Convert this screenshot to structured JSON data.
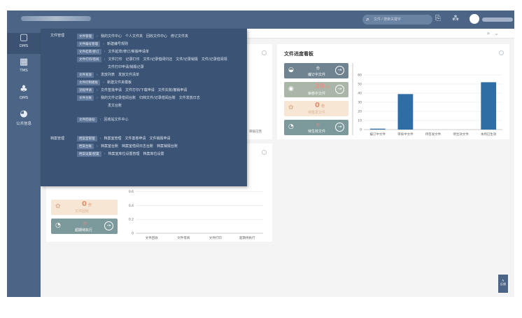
{
  "search": {
    "placeholder": "文件 / 搜索关键字"
  },
  "nav": [
    {
      "label": "DMS",
      "icon": "document-icon",
      "glyph": "🗋"
    },
    {
      "label": "TMS",
      "icon": "grid-icon",
      "glyph": "▦"
    },
    {
      "label": "QMS",
      "icon": "org-chart-icon",
      "glyph": "♣"
    },
    {
      "label": "公共信息",
      "icon": "pie-chart-icon",
      "glyph": "◕"
    }
  ],
  "menu": {
    "sections": [
      {
        "title": "文件管理"
      },
      {
        "title": "档案管理"
      }
    ],
    "rows": [
      {
        "tag": "文件管理",
        "links": [
          "我的文件中心",
          "个人文件夹",
          "回收文件中心",
          "修订文件夹"
        ]
      },
      {
        "tag": "文件编号管理",
        "links": [
          "新建编号规则"
        ]
      },
      {
        "tag": "文件起草/修订",
        "links": [
          "文件起草/修订/新版申请单"
        ]
      },
      {
        "tag": "文件打印/借阅",
        "links": [
          "文件打印",
          "记录打印",
          "文件/记录借阅归还",
          "文件/记录销毁",
          "文件/记录借阅领"
        ]
      },
      {
        "tag": "",
        "links": [
          "文件打印申请/销毁记录"
        ]
      },
      {
        "tag": "文件发放",
        "links": [
          "发放列表",
          "发放文件清单"
        ]
      },
      {
        "tag": "文件控制模板",
        "links": [
          "新建文件夹模板"
        ]
      },
      {
        "tag": "流程申请",
        "links": [
          "文件签批申请",
          "文件打印/下载申请",
          "文件失效/撤销申请"
        ]
      },
      {
        "tag": "文件台账",
        "links": [
          "我的文件记录借阅台账",
          "归档文件/记录借阅台账",
          "文件发放日志"
        ]
      },
      {
        "tag": "",
        "links": [
          "发文台账"
        ]
      },
      {
        "tag": "文件回收站",
        "links": [
          "回收站文件中心"
        ]
      },
      {
        "tag": "档案室管理",
        "links": [
          "档案室管理",
          "文件案卷申请",
          "文件销毁申请"
        ]
      },
      {
        "tag": "档案台账",
        "links": [
          "档案室台账",
          "档案室借阅日志台账",
          "档案销毁台账"
        ]
      },
      {
        "tag": "档案设置/配置",
        "links": [
          "档案室库位设置管理",
          "档案库位设置"
        ]
      }
    ]
  },
  "tiles_right": [
    {
      "num": "",
      "unit": "份",
      "label": "编订中文件",
      "style": "tile-dark",
      "icon": "edit-icon"
    },
    {
      "num": "39",
      "unit": "份",
      "label": "审核中文件",
      "style": "tile-grey",
      "icon": "review-icon"
    },
    {
      "num": "0",
      "unit": "份",
      "label": "待签发文件",
      "style": "tile-peach",
      "icon": "pending-icon"
    },
    {
      "num": "",
      "unit": "份",
      "label": "待生效文件",
      "style": "tile-teal",
      "icon": "clock-icon"
    }
  ],
  "tiles_left": [
    {
      "num": "0",
      "unit": "份",
      "label": "文件回收",
      "style": "tile-peach",
      "icon": "recycle-icon"
    },
    {
      "num": "",
      "unit": "份",
      "label": "超期待执行",
      "style": "tile-teal",
      "icon": "alarm-icon"
    }
  ],
  "cards": {
    "progress_title": "文件进度看板",
    "left_partial_label": "审核已完"
  },
  "chart_data": [
    {
      "type": "bar",
      "title": "文件进度看板",
      "categories": [
        "编订中文件",
        "审核中文件",
        "待签发文件",
        "待生效文件",
        "本周已生效"
      ],
      "values": [
        1,
        39,
        0,
        0,
        52
      ],
      "ylim": [
        0,
        60
      ],
      "yticks": [
        0,
        10,
        20,
        30,
        40,
        50,
        60
      ],
      "color": "#2f6ea5"
    },
    {
      "type": "bar",
      "categories": [
        "文件回收",
        "文件借阅",
        "文件打印",
        "超期待执行"
      ],
      "values": [
        0,
        0,
        0,
        0
      ],
      "ylim": [
        0,
        1
      ],
      "yticks": [
        "0",
        "0.2",
        "0.4",
        "0.6"
      ],
      "color": "#2f6ea5"
    }
  ],
  "side_badge": {
    "label": "反馈"
  }
}
